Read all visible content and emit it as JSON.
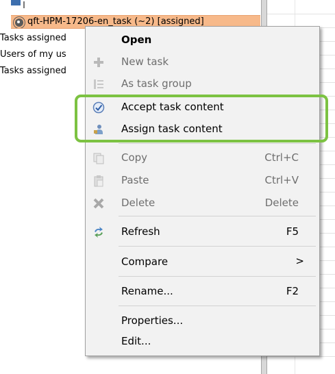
{
  "tree": {
    "selected_item": "qft-HPM-17206-en_task (~2) [assigned]",
    "rows": [
      "Tasks assigned",
      "Users of my us",
      "Tasks assigned"
    ]
  },
  "context_menu": {
    "items": [
      {
        "label": "Open",
        "shortcut": "",
        "enabled": true,
        "bold": true,
        "icon": ""
      },
      {
        "label": "New task",
        "shortcut": "",
        "enabled": false,
        "icon": "plus-icon"
      },
      {
        "label": "As task group",
        "shortcut": "",
        "enabled": false,
        "icon": "task-group-icon"
      },
      {
        "label": "Accept task content",
        "shortcut": "",
        "enabled": true,
        "icon": "accept-check-icon"
      },
      {
        "label": "Assign task content",
        "shortcut": "",
        "enabled": true,
        "icon": "assign-user-icon"
      },
      {
        "label": "Copy",
        "shortcut": "Ctrl+C",
        "enabled": false,
        "icon": "copy-icon"
      },
      {
        "label": "Paste",
        "shortcut": "Ctrl+V",
        "enabled": false,
        "icon": "paste-icon"
      },
      {
        "label": "Delete",
        "shortcut": "Delete",
        "enabled": false,
        "icon": "delete-x-icon"
      },
      {
        "label": "Refresh",
        "shortcut": "F5",
        "enabled": true,
        "icon": "refresh-icon"
      },
      {
        "label": "Compare",
        "shortcut": "",
        "enabled": true,
        "submenu": true,
        "icon": ""
      },
      {
        "label": "Rename...",
        "shortcut": "F2",
        "enabled": true,
        "icon": ""
      },
      {
        "label": "Properties...",
        "shortcut": "",
        "enabled": true,
        "icon": ""
      },
      {
        "label": "Edit...",
        "shortcut": "",
        "enabled": true,
        "icon": ""
      }
    ],
    "submenu_arrow": ">"
  },
  "highlight": {
    "color": "#7cc242"
  },
  "colors": {
    "selection": "#f7b98a",
    "menu_bg": "#f2f2f2",
    "disabled_text": "#6e6e6e"
  }
}
